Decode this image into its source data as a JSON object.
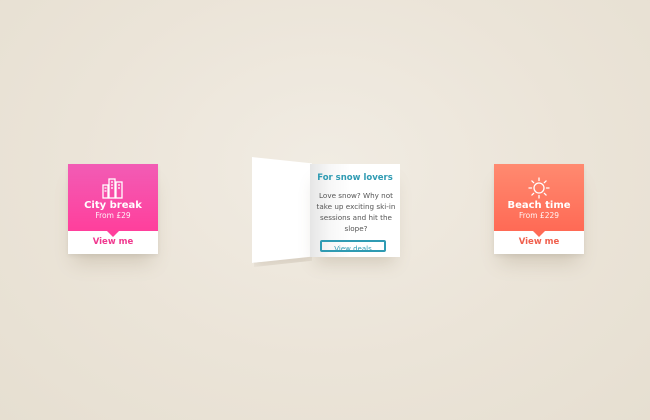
{
  "cards": {
    "city": {
      "title": "City break",
      "price": "From £29",
      "cta": "View me",
      "icon": "city-buildings-icon",
      "color": "#ff3f9c"
    },
    "snow": {
      "title": "For snow lovers",
      "body": "Love snow? Why not take up exciting ski-in sessions and hit the slope?",
      "cta": "View deals",
      "color": "#2f9bb3"
    },
    "beach": {
      "title": "Beach time",
      "price": "From £229",
      "cta": "View me",
      "icon": "sun-icon",
      "color": "#ff6a55"
    }
  }
}
